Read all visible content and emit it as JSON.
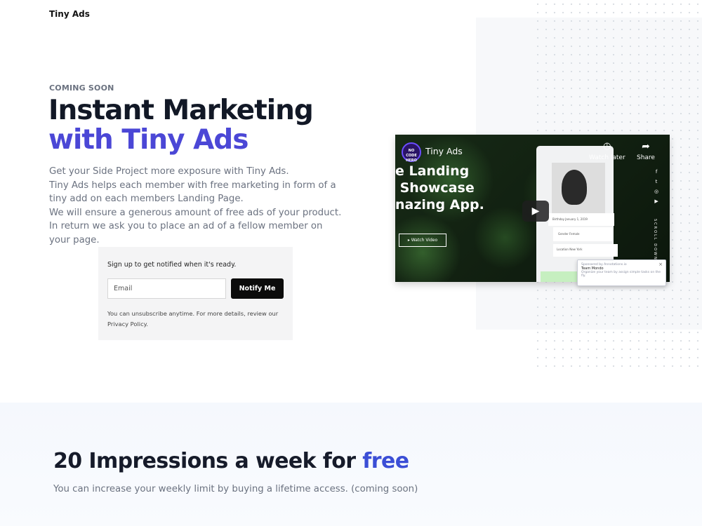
{
  "brand": "Tiny Ads",
  "hero": {
    "eyebrow": "COMING SOON",
    "title_line1": "Instant Marketing",
    "title_line2": "with Tiny Ads",
    "description": [
      "Get your Side Project more exposure with Tiny Ads.",
      "Tiny Ads helps each member with free marketing in form of a tiny add on each members Landing Page.",
      "We will ensure a generous amount of free ads of your product. In return we ask you to place an ad of a fellow member on your page."
    ]
  },
  "signup": {
    "title": "Sign up to get notified when it's ready.",
    "email_placeholder": "Email",
    "email_value": "",
    "button_label": "Notify Me",
    "fine_print": "You can unsubscribe anytime. For more details, review our",
    "privacy_link": "Privacy Policy."
  },
  "video": {
    "channel_logo": "NO CODE HERO",
    "title": "Tiny Ads",
    "overlay_text": "e Landing\n Showcase\nnazing App.",
    "watch_video": "Watch Video",
    "watch_later": "Watch later",
    "share": "Share",
    "scroll_down": "SCROLL DOWN",
    "profile_birthday_label": "Birthday",
    "profile_birthday": "January 1, 2019",
    "profile_gender_label": "Gender",
    "profile_gender_value": "Female",
    "profile_location_label": "Location",
    "profile_location": "New York",
    "popup_header": "Sponsored by Annotations.io",
    "popup_title": "Team Mondo",
    "popup_body": "Organize your team by assign simple tasks on the fly."
  },
  "section2": {
    "title_prefix": "20 Impressions a week for ",
    "title_accent": "free",
    "subtitle": "You can increase your weekly limit by buying a lifetime access. (coming soon)"
  },
  "colors": {
    "accent": "#4b47d6",
    "free_accent": "#3b4ed6",
    "button_bg": "#0b0b0b"
  }
}
